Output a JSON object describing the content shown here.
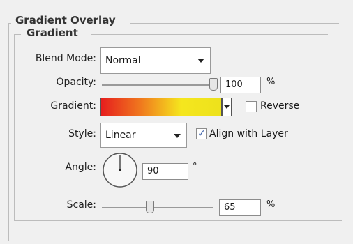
{
  "panel": {
    "title": "Gradient Overlay",
    "subtitle": "Gradient"
  },
  "blend_mode": {
    "label": "Blend Mode:",
    "value": "Normal"
  },
  "opacity": {
    "label": "Opacity:",
    "value": "100",
    "unit": "%",
    "level": 1.0
  },
  "gradient": {
    "label": "Gradient:",
    "colors": [
      "#e61e1e",
      "#f07a1e",
      "#f5e61e",
      "#ede21c"
    ],
    "reverse_label": "Reverse",
    "reverse_checked": false
  },
  "style": {
    "label": "Style:",
    "value": "Linear",
    "align_label": "Align with Layer",
    "align_checked": true,
    "check_glyph": "✓"
  },
  "angle": {
    "label": "Angle:",
    "value": "90",
    "unit": "°",
    "degrees": 90
  },
  "scale": {
    "label": "Scale:",
    "value": "65",
    "unit": "%",
    "level": 0.43
  }
}
